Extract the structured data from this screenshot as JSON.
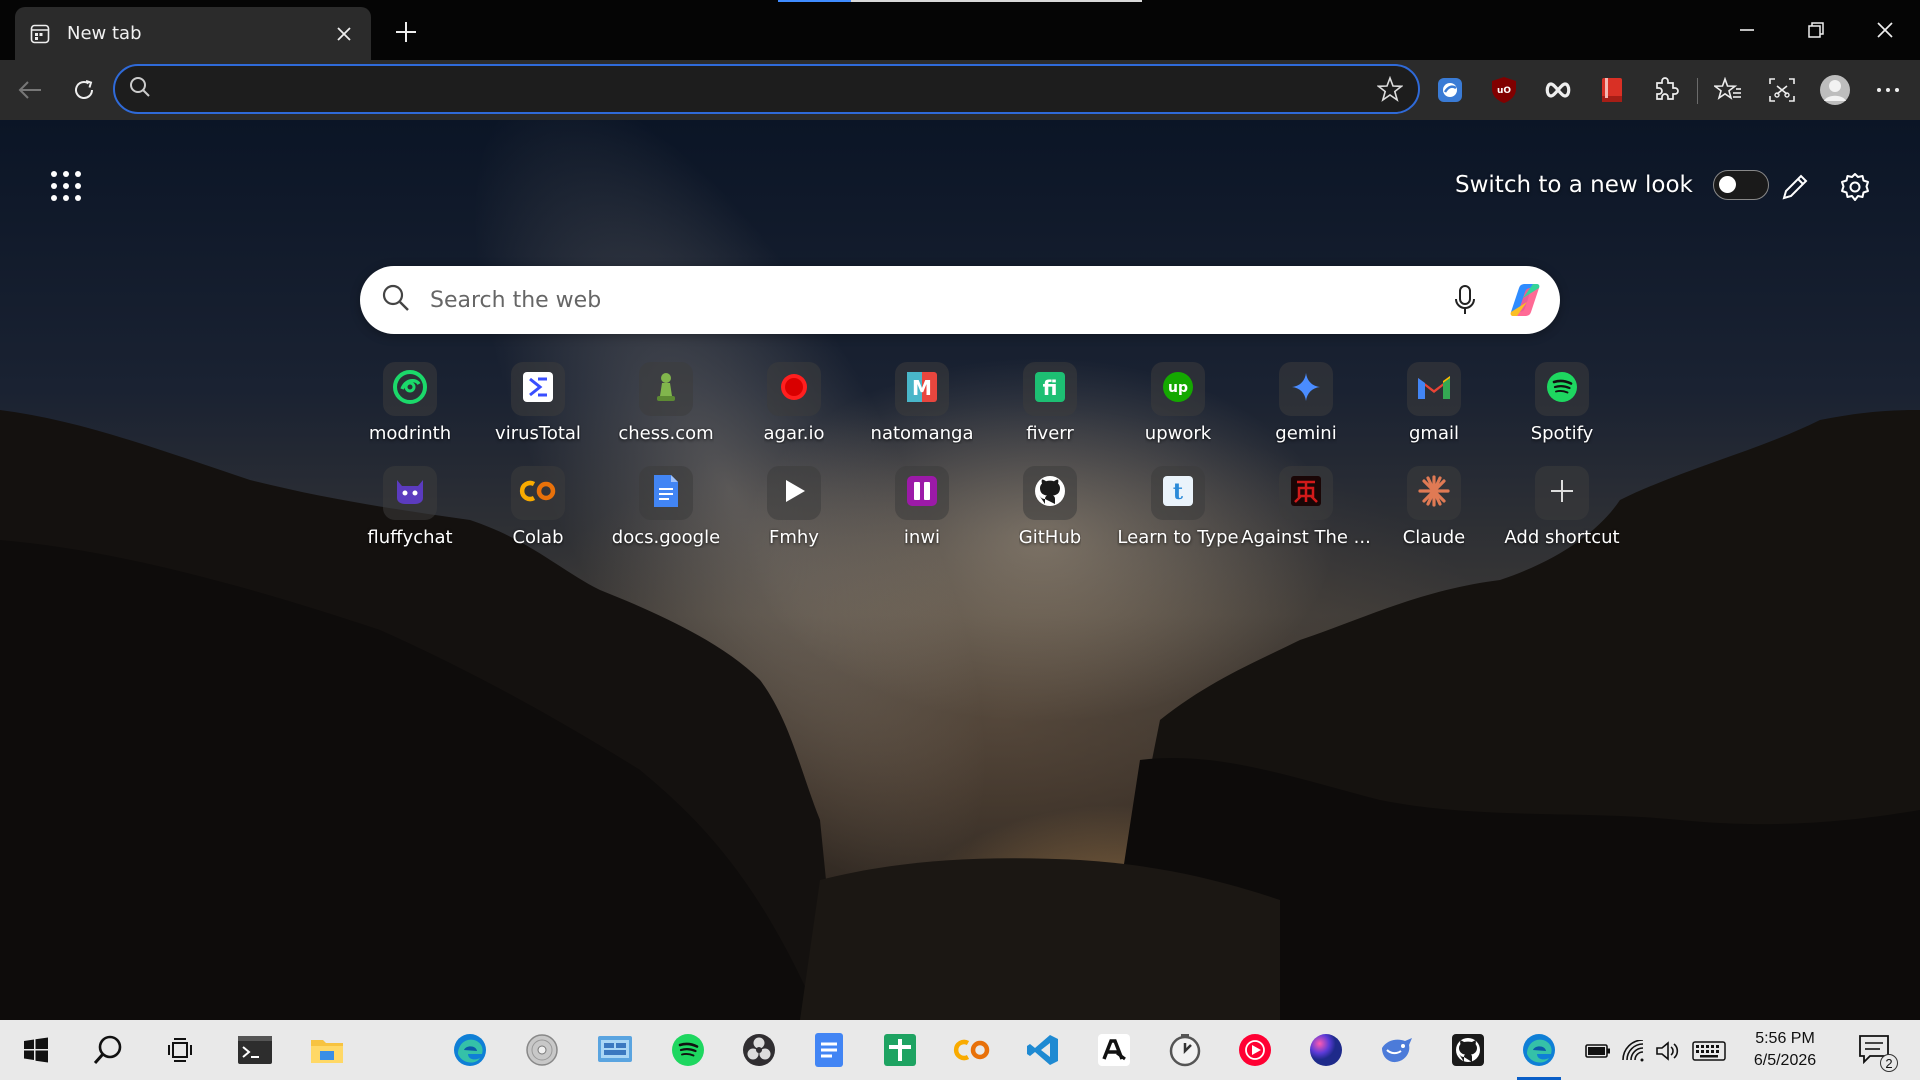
{
  "tab": {
    "title": "New tab"
  },
  "omnibox": {
    "value": "",
    "placeholder": ""
  },
  "ntp": {
    "switch_label": "Switch to a new look",
    "switch_on": false,
    "search_placeholder": "Search the web"
  },
  "shortcuts": [
    {
      "label": "modrinth",
      "icon": "modrinth-icon",
      "color": "#1bd96a"
    },
    {
      "label": "virusTotal",
      "icon": "virustotal-icon",
      "color": "#394eff"
    },
    {
      "label": "chess.com",
      "icon": "chess-pawn-icon",
      "color": "#81b64c"
    },
    {
      "label": "agar.io",
      "icon": "agar-icon",
      "color": "#ff1f1f"
    },
    {
      "label": "natomanga",
      "icon": "natomanga-icon",
      "color": "#e8463e"
    },
    {
      "label": "fiverr",
      "icon": "fiverr-icon",
      "color": "#1dbf73"
    },
    {
      "label": "upwork",
      "icon": "upwork-icon",
      "color": "#14a800"
    },
    {
      "label": "gemini",
      "icon": "gemini-icon",
      "color": "#4a8cff"
    },
    {
      "label": "gmail",
      "icon": "gmail-icon",
      "color": "#ea4335"
    },
    {
      "label": "Spotify",
      "icon": "spotify-icon",
      "color": "#1ed760"
    },
    {
      "label": "fluffychat",
      "icon": "fluffychat-icon",
      "color": "#5b3bbf"
    },
    {
      "label": "Colab",
      "icon": "colab-icon",
      "color": "#f9ab00"
    },
    {
      "label": "docs.google",
      "icon": "google-docs-icon",
      "color": "#4285f4"
    },
    {
      "label": "Fmhy",
      "icon": "play-icon",
      "color": "#ffffff"
    },
    {
      "label": "inwi",
      "icon": "inwi-icon",
      "color": "#9c1aa8"
    },
    {
      "label": "GitHub",
      "icon": "github-icon",
      "color": "#ffffff"
    },
    {
      "label": "Learn to Type",
      "icon": "learn-to-type-icon",
      "color": "#2b8ad8"
    },
    {
      "label": "Against The ...",
      "icon": "against-the-icon",
      "color": "#d21a1a"
    },
    {
      "label": "Claude",
      "icon": "claude-icon",
      "color": "#e07a54"
    },
    {
      "label": "Add shortcut",
      "icon": "plus-icon",
      "color": "#dddddd"
    }
  ],
  "taskbar": {
    "time": "5:56 PM",
    "date": "6/5/2026",
    "notification_count": "2"
  },
  "colors": {
    "accent": "#2f6ad8",
    "taskbar_bg": "#e9e9e9",
    "toolbar_bg": "#2b2b2b"
  }
}
